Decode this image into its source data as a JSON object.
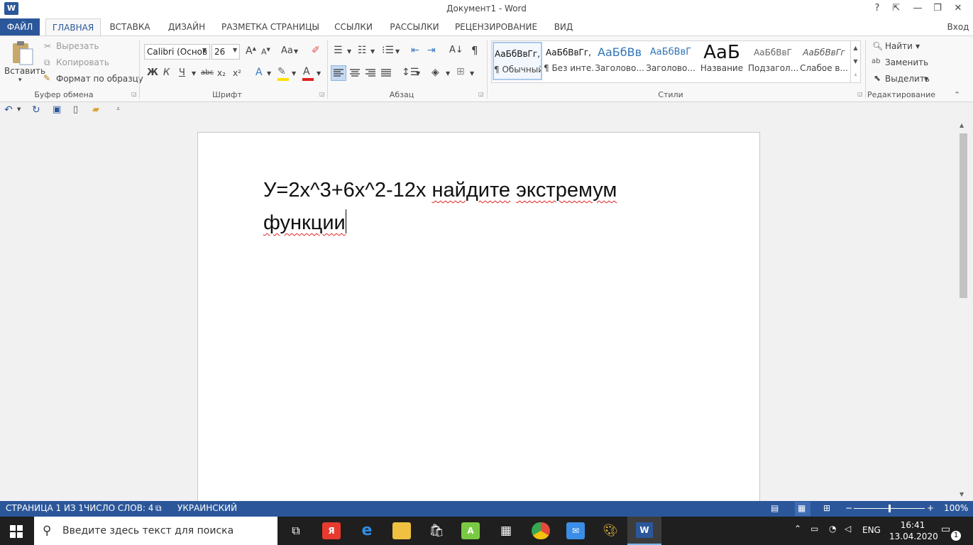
{
  "window": {
    "app_letter": "W",
    "title": "Документ1 - Word",
    "help": "?",
    "ribbon_display": "⇱",
    "minimize": "—",
    "restore": "❐",
    "close": "✕",
    "signin": "Вход"
  },
  "tabs": [
    "ФАЙЛ",
    "ГЛАВНАЯ",
    "ВСТАВКА",
    "ДИЗАЙН",
    "РАЗМЕТКА СТРАНИЦЫ",
    "ССЫЛКИ",
    "РАССЫЛКИ",
    "РЕЦЕНЗИРОВАНИЕ",
    "ВИД"
  ],
  "ribbon": {
    "clipboard": {
      "paste": "Вставить",
      "cut": "Вырезать",
      "copy": "Копировать",
      "format_painter": "Формат по образцу",
      "label": "Буфер обмена"
    },
    "font": {
      "name": "Calibri (Основ",
      "size": "26",
      "bold": "Ж",
      "italic": "К",
      "underline": "Ч",
      "strike": "abc",
      "subscript": "x₂",
      "superscript": "x²",
      "grow": "A",
      "shrink": "A",
      "case": "Aa",
      "label": "Шрифт"
    },
    "paragraph": {
      "label": "Абзац"
    },
    "styles": {
      "items": [
        {
          "sample": "АаБбВвГг,",
          "name": "¶ Обычный"
        },
        {
          "sample": "АаБбВвГг,",
          "name": "¶ Без инте..."
        },
        {
          "sample": "АаБбВв",
          "name": "Заголово..."
        },
        {
          "sample": "АаБбВвГ",
          "name": "Заголово..."
        },
        {
          "sample": "АаБ",
          "name": "Название"
        },
        {
          "sample": "АаБбВвГ",
          "name": "Подзагол..."
        },
        {
          "sample": "АаБбВвГг",
          "name": "Слабое в..."
        }
      ],
      "label": "Стили"
    },
    "editing": {
      "find": "Найти",
      "replace": "Заменить",
      "select": "Выделить",
      "label": "Редактирование"
    }
  },
  "document": {
    "line1_plain": "У=2х^3+6х^2-12х ",
    "line1_word1": "найдите",
    "line1_word2": "экстремум",
    "line2_word": "функции"
  },
  "status": {
    "page": "СТРАНИЦА 1 ИЗ 1",
    "words": "ЧИСЛО СЛОВ: 4",
    "language": "УКРАИНСКИЙ",
    "zoom": "100%",
    "zoom_fraction": 0.5
  },
  "taskbar": {
    "search_placeholder": "Введите здесь текст для поиска",
    "lang": "ENG",
    "time": "16:41",
    "date": "13.04.2020",
    "notifications": "1"
  },
  "colors": {
    "accent": "#2b579a",
    "taskbar": "#1f1f1f"
  }
}
